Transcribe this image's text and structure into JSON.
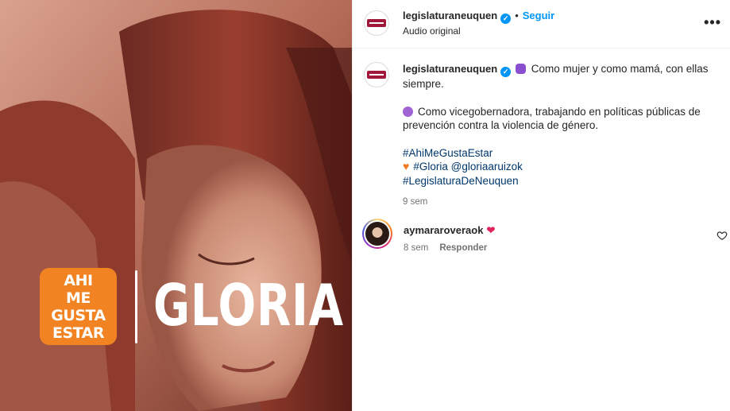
{
  "media": {
    "badge_lines": [
      "AHI",
      "ME GUSTA",
      "ESTAR"
    ],
    "title": "GLORIA",
    "accent_orange": "#f28323"
  },
  "header": {
    "username": "legislaturaneuquen",
    "separator": "•",
    "follow_label": "Seguir",
    "audio": "Audio original",
    "more_icon": "more-horizontal-icon"
  },
  "caption": {
    "username": "legislaturaneuquen",
    "line1": "Como mujer y como mamá, con ellas siempre.",
    "line2": "Como vicegobernadora, trabajando en políticas públicas de prevención contra la violencia de género.",
    "hashtag1": "#AhiMeGustaEstar",
    "hashtag2": "#Gloria",
    "mention": "@gloriaaruizok",
    "hashtag3": "#LegislaturaDeNeuquen",
    "time": "9 sem"
  },
  "comment": {
    "username": "aymararoveraok",
    "text": "❤",
    "time": "8 sem",
    "reply_label": "Responder"
  },
  "colors": {
    "link_blue": "#0095f6",
    "hashtag_navy": "#00376b",
    "muted": "#737373"
  }
}
